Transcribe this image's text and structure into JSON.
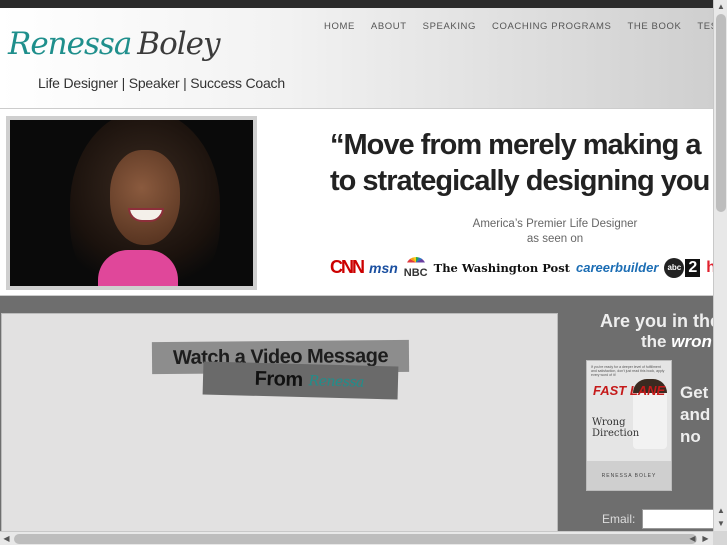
{
  "logo": {
    "first": "Renessa",
    "last": "Boley",
    "tagline": "Life Designer | Speaker | Success Coach"
  },
  "nav": [
    "HOME",
    "ABOUT",
    "SPEAKING",
    "COACHING PROGRAMS",
    "THE BOOK",
    "TESTIMONIA"
  ],
  "banner": {
    "quote_line1": "“Move from merely making a",
    "quote_line2": "to strategically designing you",
    "premier_line1": "America’s Premier Life Designer",
    "premier_line2": "as seen on",
    "media_logos": [
      "CNN",
      "msn",
      "NBC",
      "The Washington Post",
      "careerbuilder",
      "abc",
      "2",
      "heart"
    ]
  },
  "video": {
    "line1": "Watch a Video Message",
    "line2": "From",
    "signature": "Renessa"
  },
  "sidebar": {
    "q1": "Are you in the",
    "q2_prefix": "the",
    "q2_em": "wron",
    "get_lines": [
      "Get",
      "and",
      "no"
    ],
    "email_label": "Email:",
    "email_value": ""
  },
  "book": {
    "blurb": "If you're ready for a deeper level of fulfillment and satisfaction, don't just read this book, apply every word of it!",
    "title1": "FAST LANE",
    "title2": "Wrong Direction",
    "author": "RENESSA BOLEY"
  },
  "colors": {
    "accent": "#1f8f8c",
    "book_red": "#c51a1a",
    "dark_bar": "#2b2b2b",
    "panel_gray": "#6e6e6e"
  }
}
